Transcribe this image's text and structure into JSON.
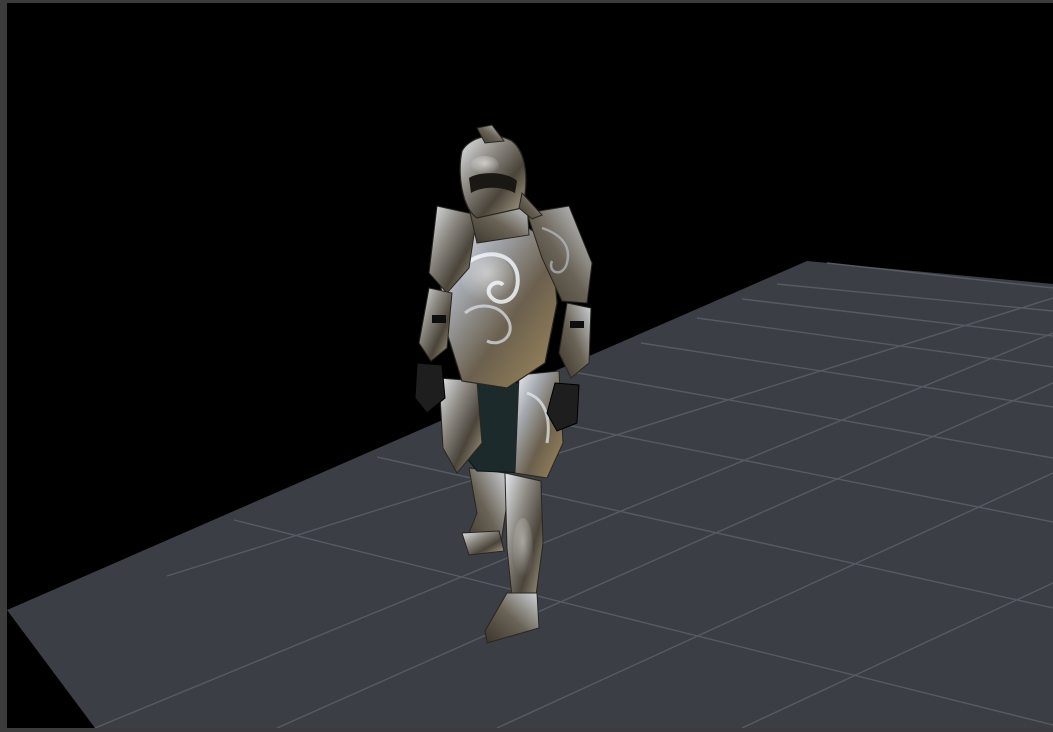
{
  "viewport": {
    "background": "#000000",
    "ground_color": "#3b3e44",
    "grid_line_color": "#595d64",
    "model_kind": "armored-knight"
  },
  "colors": {
    "steel_highlight": "#d8dde6",
    "steel_mid": "#8f8a80",
    "steel_dark": "#3b3630",
    "gold_trim": "#a8905e",
    "cloth": "#1c2a2c"
  }
}
